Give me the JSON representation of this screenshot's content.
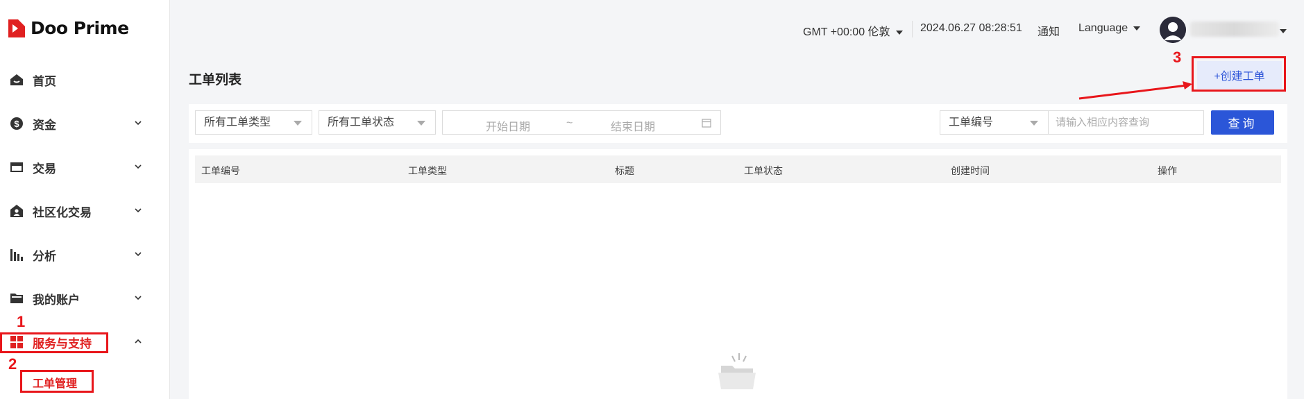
{
  "brand": {
    "name": "Doo Prime",
    "accent": "#e02020"
  },
  "sidebar": {
    "items": [
      {
        "label": "首页",
        "icon": "home-icon"
      },
      {
        "label": "资金",
        "icon": "dollar-icon"
      },
      {
        "label": "交易",
        "icon": "card-icon"
      },
      {
        "label": "社区化交易",
        "icon": "community-icon"
      },
      {
        "label": "分析",
        "icon": "bar-chart-icon"
      },
      {
        "label": "我的账户",
        "icon": "folder-icon"
      },
      {
        "label": "服务与支持",
        "icon": "grid-icon"
      }
    ],
    "sub_item": "工单管理"
  },
  "header": {
    "timezone": "GMT +00:00 伦敦",
    "datetime": "2024.06.27 08:28:51",
    "notify": "通知",
    "language": "Language"
  },
  "annotations": {
    "n1": "1",
    "n2": "2",
    "n3": "3"
  },
  "main": {
    "title": "工单列表",
    "create_button": "+创建工单",
    "filters": {
      "type_select": "所有工单类型",
      "status_select": "所有工单状态",
      "start_date": "开始日期",
      "range_sep": "~",
      "end_date": "结束日期",
      "field_select": "工单编号",
      "search_placeholder": "请输入相应内容查询",
      "query_button": "查询"
    },
    "table": {
      "columns": [
        "工单编号",
        "工单类型",
        "标题",
        "工单状态",
        "创建时间",
        "操作"
      ]
    }
  }
}
